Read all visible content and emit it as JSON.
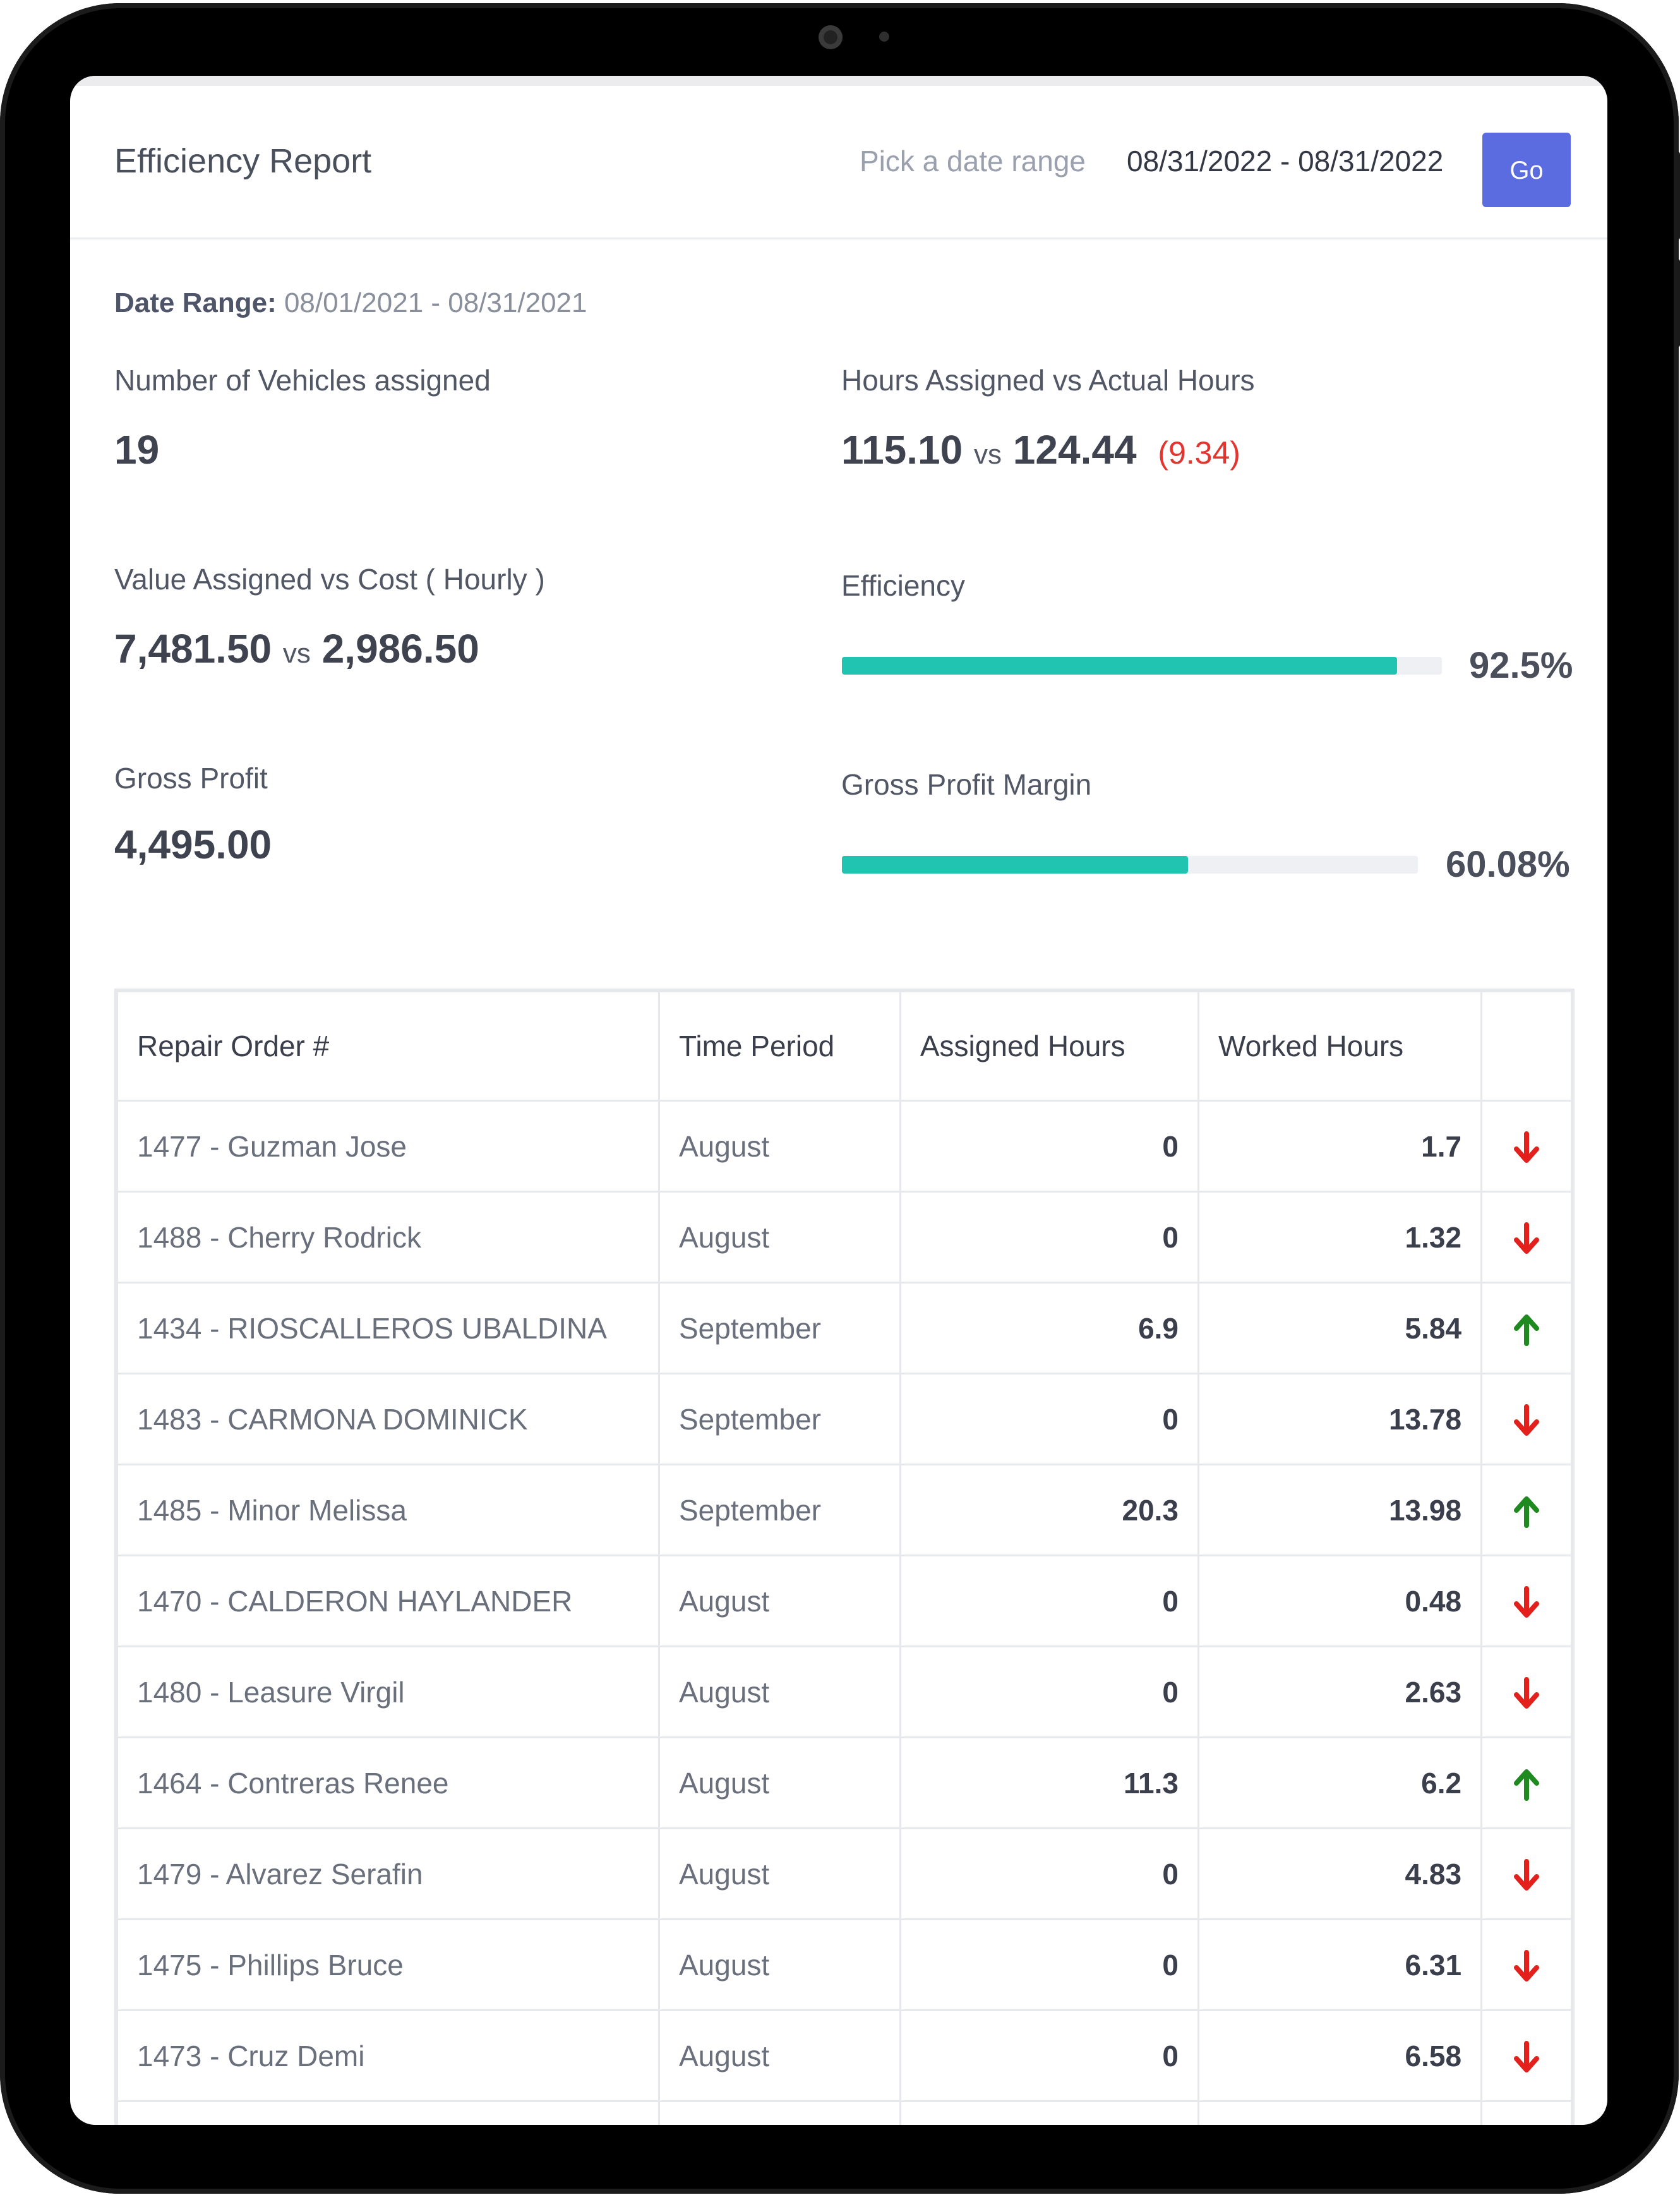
{
  "header": {
    "title": "Efficiency Report",
    "date_label": "Pick a date range",
    "date_value": "08/31/2022 - 08/31/2022",
    "go_label": "Go"
  },
  "summary": {
    "range_label": "Date Range:",
    "range_value": "08/01/2021 - 08/31/2021",
    "vehicles_label": "Number of Vehicles assigned",
    "vehicles_value": "19",
    "hours_label": "Hours Assigned vs Actual Hours",
    "hours_assigned": "115.10",
    "hours_vs": "vs",
    "hours_actual": "124.44",
    "hours_diff": "(9.34)",
    "value_label": "Value Assigned vs Cost ( Hourly )",
    "value_assigned": "7,481.50",
    "value_vs": "vs",
    "value_cost": "2,986.50",
    "efficiency_label": "Efficiency",
    "efficiency_pct": "92.5%",
    "efficiency_fraction": 0.925,
    "gross_label": "Gross Profit",
    "gross_value": "4,495.00",
    "margin_label": "Gross Profit Margin",
    "margin_pct": "60.08%",
    "margin_fraction": 0.6008
  },
  "table": {
    "columns": [
      "Repair Order #",
      "Time Period",
      "Assigned Hours",
      "Worked Hours",
      ""
    ],
    "rows": [
      {
        "order": "1477 - Guzman Jose",
        "period": "August",
        "assigned": "0",
        "worked": "1.7",
        "trend": "down"
      },
      {
        "order": "1488 - Cherry Rodrick",
        "period": "August",
        "assigned": "0",
        "worked": "1.32",
        "trend": "down"
      },
      {
        "order": "1434 - RIOSCALLEROS UBALDINA",
        "period": "September",
        "assigned": "6.9",
        "worked": "5.84",
        "trend": "up"
      },
      {
        "order": "1483 - CARMONA DOMINICK",
        "period": "September",
        "assigned": "0",
        "worked": "13.78",
        "trend": "down"
      },
      {
        "order": "1485 - Minor Melissa",
        "period": "September",
        "assigned": "20.3",
        "worked": "13.98",
        "trend": "up"
      },
      {
        "order": "1470 - CALDERON HAYLANDER",
        "period": "August",
        "assigned": "0",
        "worked": "0.48",
        "trend": "down"
      },
      {
        "order": "1480 - Leasure Virgil",
        "period": "August",
        "assigned": "0",
        "worked": "2.63",
        "trend": "down"
      },
      {
        "order": "1464 - Contreras Renee",
        "period": "August",
        "assigned": "11.3",
        "worked": "6.2",
        "trend": "up"
      },
      {
        "order": "1479 - Alvarez Serafin",
        "period": "August",
        "assigned": "0",
        "worked": "4.83",
        "trend": "down"
      },
      {
        "order": "1475 - Phillips Bruce",
        "period": "August",
        "assigned": "0",
        "worked": "6.31",
        "trend": "down"
      },
      {
        "order": "1473 - Cruz Demi",
        "period": "August",
        "assigned": "0",
        "worked": "6.58",
        "trend": "down"
      },
      {
        "order": "",
        "period": "",
        "assigned": "",
        "worked": "",
        "trend": ""
      }
    ]
  },
  "colors": {
    "accent": "#5b6be0",
    "progress": "#20c4b0",
    "down": "#e3201b",
    "up": "#1f8a1f"
  }
}
